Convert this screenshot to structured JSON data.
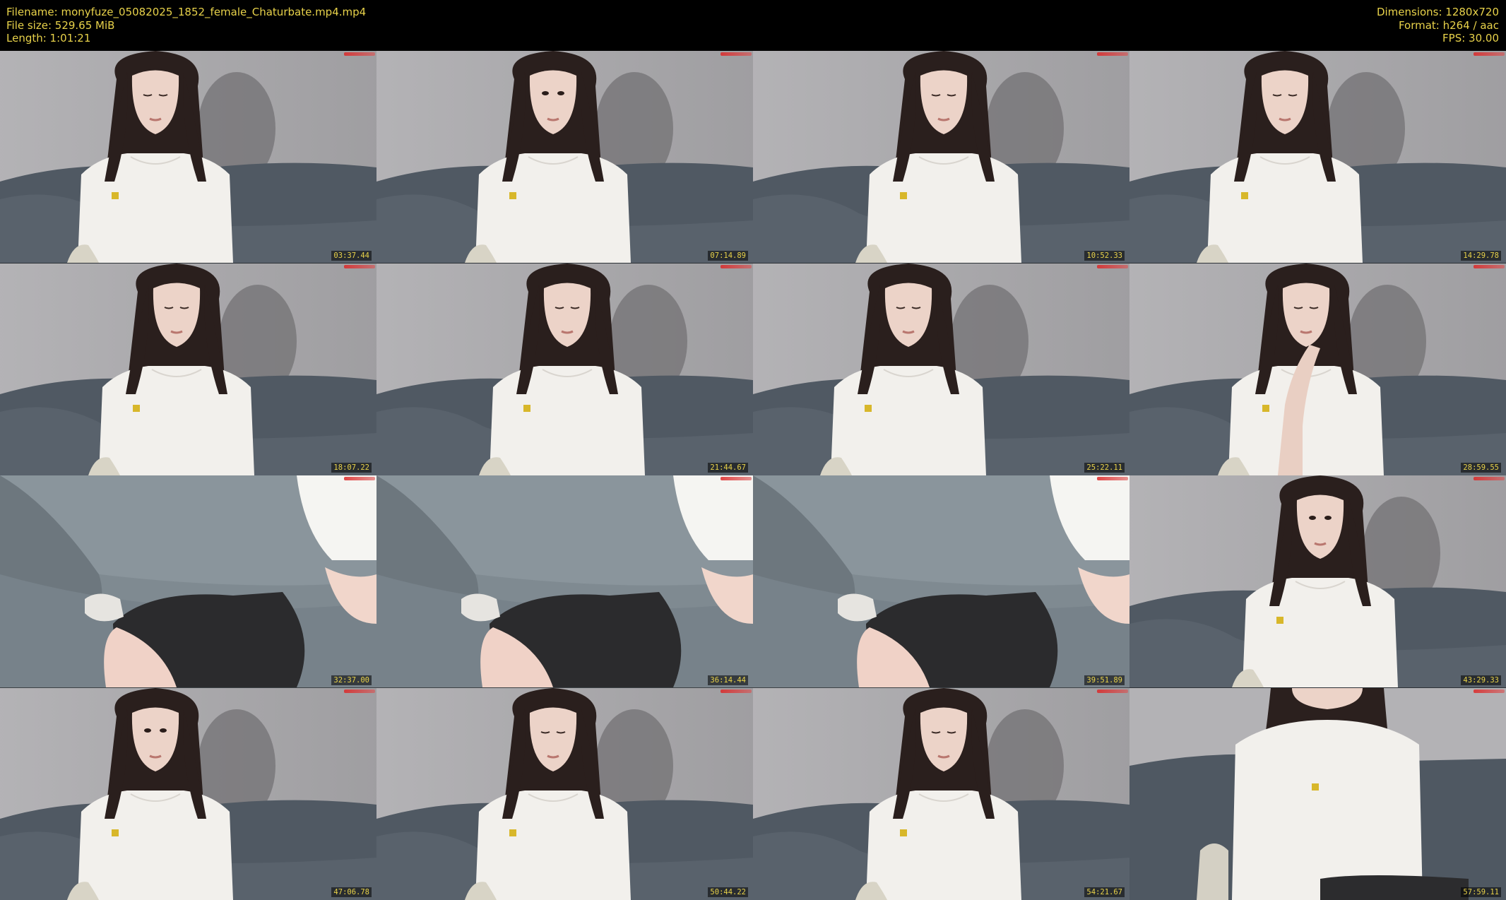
{
  "metadata": {
    "filename": "Filename: monyfuze_05082025_1852_female_Chaturbate.mp4.mp4",
    "filesize": "File size: 529.65 MiB",
    "length": "Length: 1:01:21",
    "dimensions": "Dimensions: 1280x720",
    "format": "Format: h264 / aac",
    "fps": "FPS: 30.00"
  },
  "colors": {
    "text": "#e8d24a",
    "background": "#000000"
  },
  "thumbnails": [
    {
      "timestamp": "03:37.44",
      "scene": "seated-looking-down"
    },
    {
      "timestamp": "07:14.89",
      "scene": "seated-looking-forward"
    },
    {
      "timestamp": "10:52.33",
      "scene": "seated-looking-down"
    },
    {
      "timestamp": "14:29.78",
      "scene": "seated-looking-down"
    },
    {
      "timestamp": "18:07.22",
      "scene": "seated-looking-down"
    },
    {
      "timestamp": "21:44.67",
      "scene": "seated-looking-down"
    },
    {
      "timestamp": "25:22.11",
      "scene": "seated-looking-down"
    },
    {
      "timestamp": "28:59.55",
      "scene": "seated-hand-to-mouth"
    },
    {
      "timestamp": "32:37.00",
      "scene": "couch-close-up"
    },
    {
      "timestamp": "36:14.44",
      "scene": "couch-close-up"
    },
    {
      "timestamp": "39:51.89",
      "scene": "couch-close-up"
    },
    {
      "timestamp": "43:29.33",
      "scene": "seated-looking-forward"
    },
    {
      "timestamp": "47:06.78",
      "scene": "seated-looking-forward"
    },
    {
      "timestamp": "50:44.22",
      "scene": "seated-looking-down"
    },
    {
      "timestamp": "54:21.67",
      "scene": "seated-looking-down"
    },
    {
      "timestamp": "57:59.11",
      "scene": "standing-cropped"
    }
  ]
}
